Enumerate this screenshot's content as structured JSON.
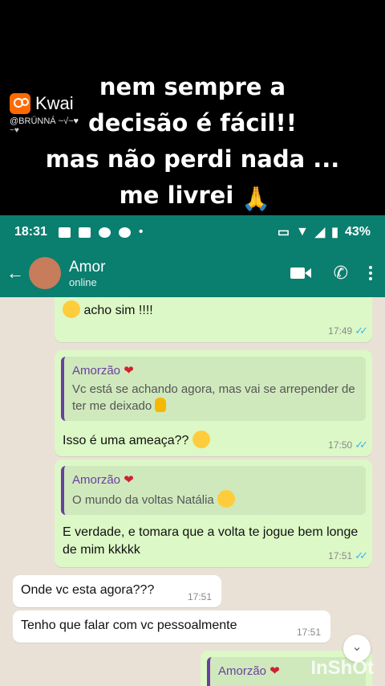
{
  "overlay": {
    "caption": [
      "nem sempre a",
      "decisão é fácil!!",
      "mas não perdi nada ...",
      "me livrei"
    ],
    "brand": "Kwai",
    "handle": "@BRÜNNÁ ~√~♥",
    "handle_extra": "~♥"
  },
  "statusbar": {
    "time": "18:31",
    "battery": "43%"
  },
  "header": {
    "contact_name": "Amor",
    "contact_status": "online"
  },
  "messages": [
    {
      "type": "out",
      "text": "acho sim !!!!",
      "time": "17:49"
    },
    {
      "type": "out",
      "quote_name": "Amorzão",
      "quote_text": "Vc está se achando agora, mas vai se arrepender de ter me deixado",
      "text": "Isso é uma ameaça??",
      "time": "17:50"
    },
    {
      "type": "out",
      "quote_name": "Amorzão",
      "quote_text": "O mundo da voltas Natália",
      "text": "E verdade, e tomara que a volta te jogue bem longe de mim kkkkk",
      "time": "17:51"
    },
    {
      "type": "in",
      "text": "Onde vc esta agora???",
      "time": "17:51"
    },
    {
      "type": "in",
      "text": "Tenho que falar com vc pessoalmente",
      "time": "17:51"
    },
    {
      "type": "out",
      "quote_name": "Amorzão"
    }
  ],
  "watermark": "InShOt"
}
